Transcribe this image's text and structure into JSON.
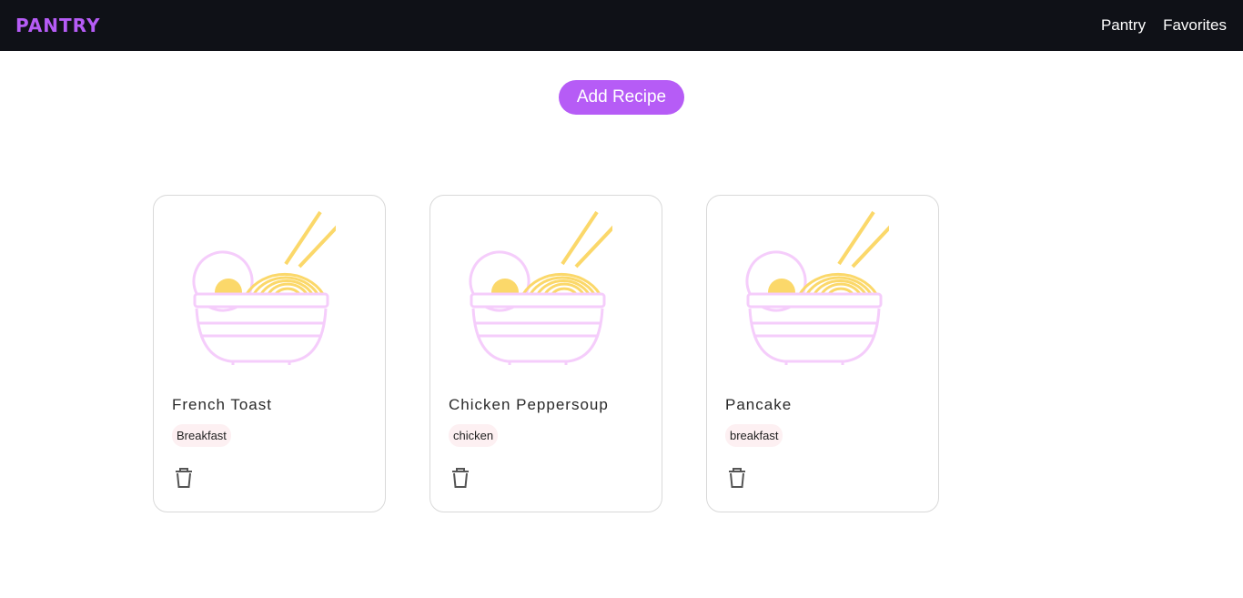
{
  "navbar": {
    "logo": "PANTRY",
    "links": [
      "Pantry",
      "Favorites"
    ]
  },
  "actions": {
    "add_recipe_label": "Add Recipe"
  },
  "recipes": [
    {
      "title": "French Toast",
      "tag": "Breakfast",
      "image_icon": "ramen-bowl-icon",
      "delete_icon": "trash-icon"
    },
    {
      "title": "Chicken Peppersoup",
      "tag": "chicken",
      "image_icon": "ramen-bowl-icon",
      "delete_icon": "trash-icon"
    },
    {
      "title": "Pancake",
      "tag": "breakfast",
      "image_icon": "ramen-bowl-icon",
      "delete_icon": "trash-icon"
    }
  ],
  "colors": {
    "navbar_bg": "#0f1117",
    "accent": "#b65cf6",
    "bowl": "#f5cdfb",
    "noodles": "#fbd86a",
    "tag_bg": "#fdf0f2"
  }
}
